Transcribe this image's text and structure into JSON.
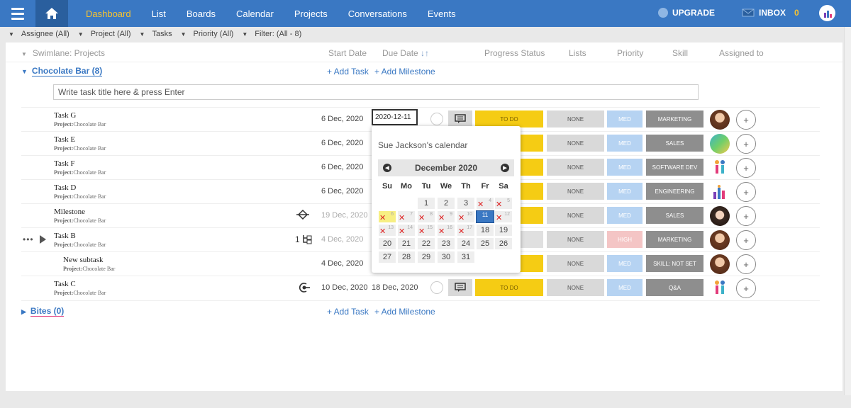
{
  "nav": {
    "items": [
      "Dashboard",
      "List",
      "Boards",
      "Calendar",
      "Projects",
      "Conversations",
      "Events"
    ],
    "upgrade": "UPGRADE",
    "inbox": "INBOX",
    "inbox_count": "0"
  },
  "filters": [
    "Assignee (All)",
    "Project (All)",
    "Tasks",
    "Priority (All)",
    "Filter: (All - 8)"
  ],
  "columns": {
    "swimlane": "Swimlane: Projects",
    "start": "Start Date",
    "due": "Due Date",
    "progress": "Progress Status",
    "lists": "Lists",
    "priority": "Priority",
    "skill": "Skill",
    "assigned": "Assigned to"
  },
  "groups": [
    {
      "name": "Chocolate Bar (8)",
      "add_task": "+ Add Task",
      "add_milestone": "+ Add Milestone"
    },
    {
      "name": "Bites (0)",
      "add_task": "+ Add Task",
      "add_milestone": "+ Add Milestone"
    }
  ],
  "task_input_placeholder": "Write task title here & press Enter",
  "project_prefix": "Project:",
  "rows": [
    {
      "name": "Task G",
      "project": "Chocolate Bar",
      "start": "6 Dec, 2020",
      "due": "",
      "status": "TO DO",
      "list": "NONE",
      "priority": "MED",
      "skill": "MARKETING"
    },
    {
      "name": "Task E",
      "project": "Chocolate Bar",
      "start": "6 Dec, 2020",
      "due": "",
      "status": "",
      "list": "NONE",
      "priority": "MED",
      "skill": "SALES"
    },
    {
      "name": "Task F",
      "project": "Chocolate Bar",
      "start": "6 Dec, 2020",
      "due": "",
      "status": "",
      "list": "NONE",
      "priority": "MED",
      "skill": "SOFTWARE DEV"
    },
    {
      "name": "Task D",
      "project": "Chocolate Bar",
      "start": "6 Dec, 2020",
      "due": "",
      "status": "",
      "list": "NONE",
      "priority": "MED",
      "skill": "ENGINEERING"
    },
    {
      "name": "Milestone",
      "project": "Chocolate Bar",
      "start": "19 Dec, 2020",
      "due": "",
      "status": "",
      "list": "NONE",
      "priority": "MED",
      "skill": "SALES"
    },
    {
      "name": "Task B",
      "project": "Chocolate Bar",
      "start": "4 Dec, 2020",
      "due": "",
      "status": "",
      "list": "NONE",
      "priority": "HIGH",
      "skill": "MARKETING",
      "subtasks": "1"
    },
    {
      "name": "New subtask",
      "project": "Chocolate Bar",
      "start": "4 Dec, 2020",
      "due": "",
      "status": "",
      "list": "NONE",
      "priority": "MED",
      "skill": "SKILL: NOT SET"
    },
    {
      "name": "Task C",
      "project": "Chocolate Bar",
      "start": "10 Dec, 2020",
      "due": "18 Dec, 2020",
      "status": "TO DO",
      "list": "NONE",
      "priority": "MED",
      "skill": "Q&A"
    }
  ],
  "date_input_value": "2020-12-11",
  "calendar": {
    "title": "Sue Jackson's calendar",
    "month": "December 2020",
    "dow": [
      "Su",
      "Mo",
      "Tu",
      "We",
      "Th",
      "Fr",
      "Sa"
    ],
    "weeks": [
      [
        "",
        "",
        "1",
        "2",
        "3",
        "4",
        "5"
      ],
      [
        "6",
        "7",
        "8",
        "9",
        "10",
        "11",
        "12"
      ],
      [
        "13",
        "14",
        "15",
        "16",
        "17",
        "18",
        "19"
      ],
      [
        "20",
        "21",
        "22",
        "23",
        "24",
        "25",
        "26"
      ],
      [
        "27",
        "28",
        "29",
        "30",
        "31",
        "",
        ""
      ]
    ],
    "disabled": [
      "4",
      "5",
      "6",
      "7",
      "8",
      "9",
      "10",
      "12",
      "13",
      "14",
      "15",
      "16",
      "17"
    ],
    "today": "6",
    "selected": "11"
  },
  "colors": {
    "nav_bg": "#3a78c3",
    "nav_active": "#f7c331",
    "status_todo": "#f5cc14",
    "priority_med": "#b6d3f2",
    "priority_high": "#f4c5c5",
    "skill": "#8e8e8e"
  }
}
